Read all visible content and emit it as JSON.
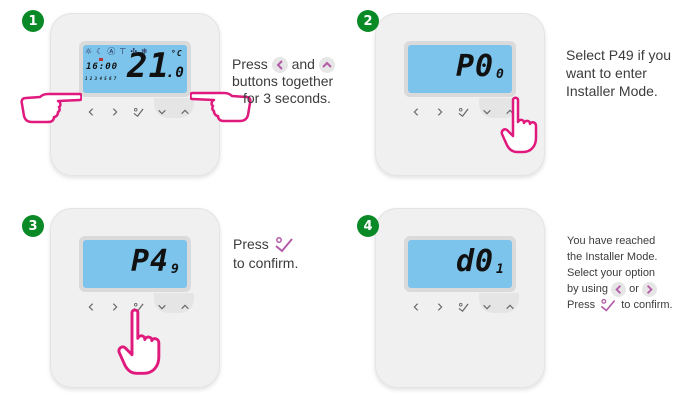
{
  "steps": [
    {
      "number": "1",
      "lcd": {
        "clock": "16:00",
        "temp_main": "21",
        "temp_decimal": ".0",
        "unit": "°C",
        "days": "1 2 3 4 5 6 7"
      },
      "caption": {
        "line1_a": "Press",
        "line1_b": "and",
        "line2": "buttons together",
        "line3": "for 3 seconds."
      }
    },
    {
      "number": "2",
      "lcd": {
        "code": "P0",
        "sub": "0"
      },
      "caption": {
        "line1": "Select P49 if you",
        "line2": "want to enter",
        "line3": "Installer Mode."
      }
    },
    {
      "number": "3",
      "lcd": {
        "code": "P4",
        "sub": "9"
      },
      "caption": {
        "line1": "Press",
        "line2": "to confirm."
      }
    },
    {
      "number": "4",
      "lcd": {
        "code": "d0",
        "sub": "1"
      },
      "caption": {
        "line1": "You have reached",
        "line2": "the Installer Mode.",
        "line3": "Select your option",
        "line4_a": "by using",
        "line4_b": "or",
        "line5_a": "Press",
        "line5_b": "to confirm."
      }
    }
  ],
  "colors": {
    "badge": "#0a8a26",
    "hand": "#e0197d",
    "lcd": "#7cc4ec",
    "icon": "#b35aa8"
  }
}
